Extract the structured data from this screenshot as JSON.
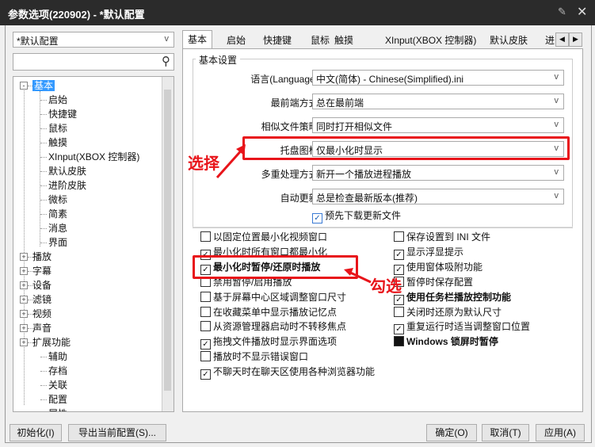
{
  "window": {
    "title": "参数选项(220902) - *默认配置"
  },
  "profile_select": "*默认配置",
  "search": {
    "placeholder": ""
  },
  "tree": [
    {
      "label": "基本"
    },
    {
      "label": "启始"
    },
    {
      "label": "快捷键"
    },
    {
      "label": "鼠标"
    },
    {
      "label": "触摸"
    },
    {
      "label": "XInput(XBOX 控制器)"
    },
    {
      "label": "默认皮肤"
    },
    {
      "label": "进阶皮肤"
    },
    {
      "label": "微标"
    },
    {
      "label": "简素"
    },
    {
      "label": "消息"
    },
    {
      "label": "界面"
    },
    {
      "label": "播放"
    },
    {
      "label": "字幕"
    },
    {
      "label": "设备"
    },
    {
      "label": "滤镜"
    },
    {
      "label": "视频"
    },
    {
      "label": "声音"
    },
    {
      "label": "扩展功能"
    },
    {
      "label": "辅助"
    },
    {
      "label": "存档"
    },
    {
      "label": "关联"
    },
    {
      "label": "配置"
    },
    {
      "label": "属性"
    }
  ],
  "tabs": [
    "基本",
    "启始",
    "快捷键",
    "鼠标",
    "触摸",
    "XInput(XBOX 控制器)",
    "默认皮肤",
    "进"
  ],
  "basic": {
    "group_title": "基本设置",
    "language_label": "语言(Language):",
    "language_value": "中文(简体) - Chinese(Simplified).ini",
    "topmost_label": "最前端方式:",
    "topmost_value": "总在最前端",
    "similar_label": "相似文件策略:",
    "similar_value": "同时打开相似文件",
    "tray_label": "托盘图标:",
    "tray_value": "仅最小化时显示",
    "multi_label": "多重处理方式:",
    "multi_value": "新开一个播放进程播放",
    "update_label": "自动更新:",
    "update_value": "总是检查最新版本(推荐)",
    "predownload": "预先下载更新文件"
  },
  "options_left": [
    {
      "label": "以固定位置最小化视频窗口",
      "checked": false,
      "bold": false
    },
    {
      "label": "最小化时所有窗口都最小化",
      "checked": true,
      "bold": false
    },
    {
      "label": "最小化时暂停/还原时播放",
      "checked": true,
      "bold": true
    },
    {
      "label": "禁用暂停/启用播放",
      "checked": false,
      "bold": false
    },
    {
      "label": "基于屏幕中心区域调整窗口尺寸",
      "checked": false,
      "bold": false
    },
    {
      "label": "在收藏菜单中显示播放记忆点",
      "checked": false,
      "bold": false
    },
    {
      "label": "从资源管理器启动时不转移焦点",
      "checked": false,
      "bold": false
    },
    {
      "label": "拖拽文件播放时显示界面选项",
      "checked": true,
      "bold": false
    },
    {
      "label": "播放时不显示错误窗口",
      "checked": false,
      "bold": false
    },
    {
      "label": "不聊天时在聊天区使用各种浏览器功能",
      "checked": true,
      "bold": false
    }
  ],
  "options_right": [
    {
      "label": "保存设置到 INI 文件",
      "checked": false,
      "bold": false
    },
    {
      "label": "显示浮显提示",
      "checked": true,
      "bold": false
    },
    {
      "label": "使用窗体吸附功能",
      "checked": true,
      "bold": false
    },
    {
      "label": "暂停时保存配置",
      "checked": false,
      "bold": false
    },
    {
      "label": "使用任务栏播放控制功能",
      "checked": true,
      "bold": true
    },
    {
      "label": "关闭时还原为默认尺寸",
      "checked": false,
      "bold": false
    },
    {
      "label": "重复运行时适当调整窗口位置",
      "checked": true,
      "bold": false
    },
    {
      "label": "Windows 锁屏时暂停",
      "checked": "filled",
      "bold": true
    }
  ],
  "buttons": {
    "init": "初始化(I)",
    "export": "导出当前配置(S)...",
    "ok": "确定(O)",
    "cancel": "取消(T)",
    "apply": "应用(A)"
  },
  "annotations": {
    "select": "选择",
    "check": "勾选"
  },
  "colors": {
    "annotation": "#e8141a",
    "selection": "#3399ff",
    "titlebar": "#2b2b2b"
  }
}
